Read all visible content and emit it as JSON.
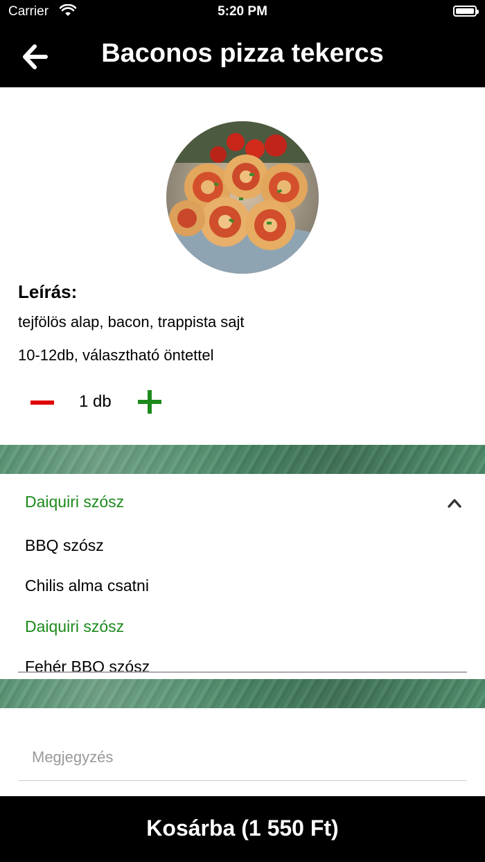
{
  "status": {
    "carrier": "Carrier",
    "time": "5:20 PM"
  },
  "header": {
    "title": "Baconos pizza tekercs",
    "back_icon": "arrow-left-icon"
  },
  "product": {
    "image_desc_icon": "pizza-roll-photo",
    "description_heading": "Leírás:",
    "description_lines": [
      "tejfölös alap, bacon, trappista sajt",
      "10-12db, választható öntettel"
    ],
    "quantity": "1 db"
  },
  "sauce": {
    "selected": "Daiquiri szósz",
    "options": [
      "BBQ szósz",
      "Chilis alma csatni",
      "Daiquiri szósz",
      "Fehér BBQ szósz"
    ]
  },
  "note": {
    "placeholder": "Megjegyzés"
  },
  "cart": {
    "label": "Kosárba (1 550 Ft)"
  },
  "colors": {
    "accent_green": "#1c8a1c",
    "minus_red": "#e00000",
    "bar_black": "#000000"
  }
}
